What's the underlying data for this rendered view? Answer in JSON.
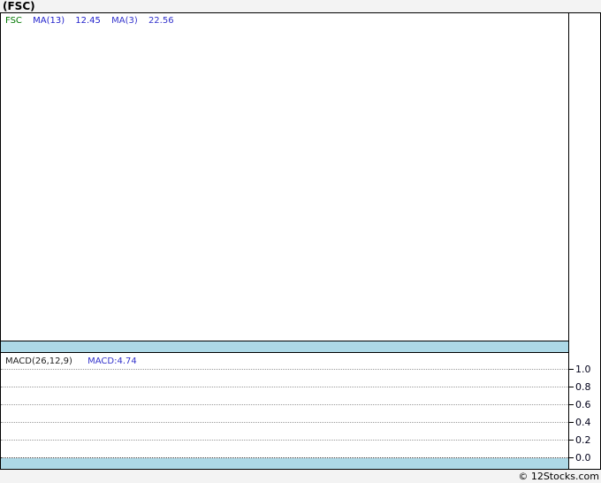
{
  "title": "(FSC)",
  "price_panel": {
    "legend": {
      "symbol": "FSC",
      "ma13_label": "MA(13)",
      "ma13_value": "12.45",
      "ma3_label": "MA(3)",
      "ma3_value": "22.56"
    }
  },
  "macd_panel": {
    "params_label": "MACD(26,12,9)",
    "value_label": "MACD:4.74",
    "axis_ticks": [
      "1.0",
      "0.8",
      "0.6",
      "0.4",
      "0.2",
      "0.0"
    ]
  },
  "footer": {
    "copyright": "© 12Stocks.com"
  },
  "colors": {
    "symbol_green": "#007700",
    "ma13_blue": "#2222cc",
    "ma3_blue": "#3333cc",
    "macd_value_blue": "#3333cc",
    "band_cyan": "#add8e6",
    "grid_dotted_gray": "#9a9a9a",
    "zero_line_dark": "#3a3a3a",
    "page_background": "#f3f3f3"
  },
  "chart_data": [
    {
      "type": "line",
      "title": "(FSC) price panel",
      "series": [
        {
          "name": "FSC",
          "color": "#007700",
          "values": []
        },
        {
          "name": "MA(13)",
          "last_value": 12.45,
          "color": "#2222cc",
          "values": []
        },
        {
          "name": "MA(3)",
          "last_value": 22.56,
          "color": "#3333cc",
          "values": []
        }
      ],
      "note": "price panel is empty - no candles or line data plotted",
      "grid": "off",
      "legend_position": "top-left"
    },
    {
      "type": "line",
      "title": "MACD(26,12,9)",
      "series": [
        {
          "name": "MACD",
          "last_value": 4.74,
          "values": []
        }
      ],
      "ylabel": "",
      "ytick_labels": [
        "1.0",
        "0.8",
        "0.6",
        "0.4",
        "0.2",
        "0.0"
      ],
      "ylim": [
        0.0,
        1.0
      ],
      "grid": "dotted horizontal gridlines at each 0.2 step, darker zero line",
      "legend_position": "top-left",
      "note": "no MACD curve plotted in visible range"
    }
  ]
}
